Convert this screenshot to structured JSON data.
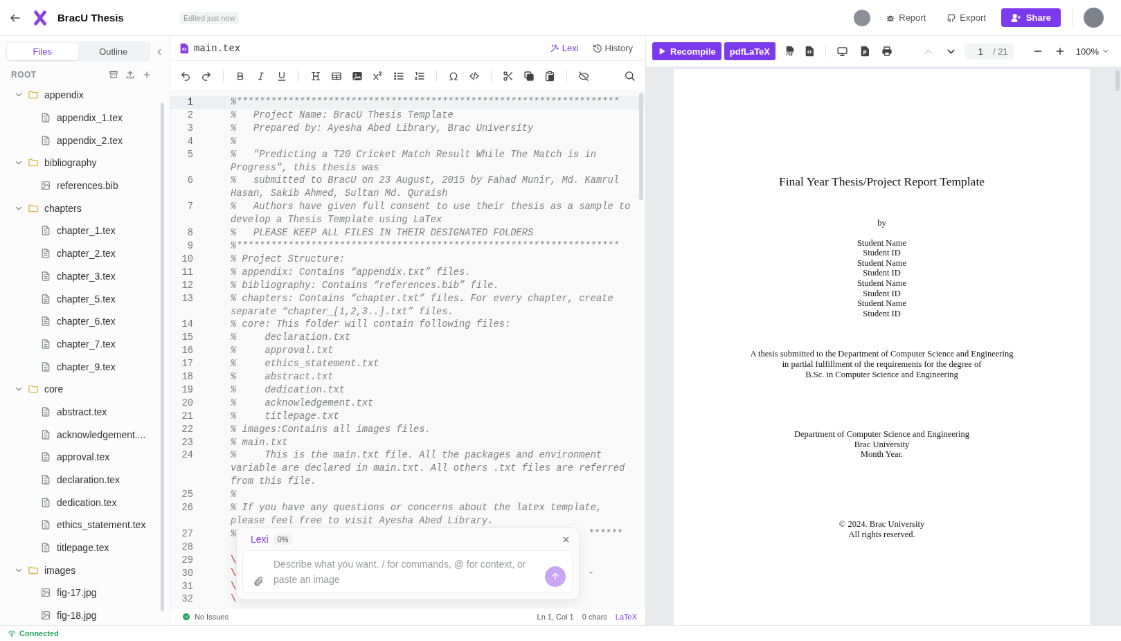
{
  "header": {
    "title": "BracU Thesis",
    "status": "Edited just now",
    "actions": [
      {
        "kind": "link",
        "label": "Report"
      },
      {
        "kind": "link",
        "label": "Export"
      },
      {
        "kind": "primary",
        "label": "Share"
      }
    ]
  },
  "sidebar": {
    "tabs": [
      {
        "label": "Files",
        "selected": true
      },
      {
        "label": "Outline",
        "selected": false
      }
    ],
    "root_label": "ROOT",
    "tree": [
      {
        "kind": "folder",
        "name": "appendix",
        "expanded": true,
        "children": [
          {
            "kind": "document",
            "name": "appendix_1.tex"
          },
          {
            "kind": "document",
            "name": "appendix_2.tex"
          }
        ]
      },
      {
        "kind": "folder",
        "name": "bibliography",
        "expanded": true,
        "children": [
          {
            "kind": "image",
            "name": "references.bib"
          }
        ]
      },
      {
        "kind": "folder",
        "name": "chapters",
        "expanded": true,
        "children": [
          {
            "kind": "document",
            "name": "chapter_1.tex"
          },
          {
            "kind": "document",
            "name": "chapter_2.tex"
          },
          {
            "kind": "document",
            "name": "chapter_3.tex"
          },
          {
            "kind": "document",
            "name": "chapter_5.tex"
          },
          {
            "kind": "document",
            "name": "chapter_6.tex"
          },
          {
            "kind": "document",
            "name": "chapter_7.tex"
          },
          {
            "kind": "document",
            "name": "chapter_9.tex"
          }
        ]
      },
      {
        "kind": "folder",
        "name": "core",
        "expanded": true,
        "children": [
          {
            "kind": "document",
            "name": "abstract.tex"
          },
          {
            "kind": "document",
            "name": "acknowledgement...."
          },
          {
            "kind": "document",
            "name": "approval.tex"
          },
          {
            "kind": "document",
            "name": "declaration.tex"
          },
          {
            "kind": "document",
            "name": "dedication.tex"
          },
          {
            "kind": "document",
            "name": "ethics_statement.tex"
          },
          {
            "kind": "document",
            "name": "titlepage.tex"
          }
        ]
      },
      {
        "kind": "folder",
        "name": "images",
        "expanded": true,
        "children": [
          {
            "kind": "image",
            "name": "fig-17.jpg"
          },
          {
            "kind": "image",
            "name": "fig-18.jpg"
          }
        ]
      }
    ]
  },
  "editor": {
    "file": "main.tex",
    "actions": [
      {
        "kind": "ai",
        "label": "Lexi"
      },
      {
        "kind": "plain",
        "label": "History"
      }
    ],
    "lines": [
      {
        "number": "1",
        "kind": "comment",
        "active": true,
        "text": "%*******************************************************************"
      },
      {
        "number": "2",
        "kind": "comment",
        "active": false,
        "text": "%   Project Name: BracU Thesis Template"
      },
      {
        "number": "3",
        "kind": "comment",
        "active": false,
        "text": "%   Prepared by: Ayesha Abed Library, Brac University"
      },
      {
        "number": "4",
        "kind": "comment",
        "active": false,
        "text": "%"
      },
      {
        "number": "5",
        "kind": "comment",
        "active": false,
        "text": "%   \"Predicting a T20 Cricket Match Result While The Match is in Progress\", this thesis was"
      },
      {
        "number": "6",
        "kind": "comment",
        "active": false,
        "text": "%   submitted to BracU on 23 August, 2015 by Fahad Munir, Md. Kamrul Hasan, Sakib Ahmed, Sultan Md. Quraish"
      },
      {
        "number": "7",
        "kind": "comment",
        "active": false,
        "text": "%   Authors have given full consent to use their thesis as a sample to develop a Thesis Template using LaTex"
      },
      {
        "number": "8",
        "kind": "comment",
        "active": false,
        "text": "%   PLEASE KEEP ALL FILES IN THEIR DESIGNATED FOLDERS"
      },
      {
        "number": "9",
        "kind": "comment",
        "active": false,
        "text": "%*******************************************************************"
      },
      {
        "number": "10",
        "kind": "comment",
        "active": false,
        "text": "% Project Structure:"
      },
      {
        "number": "11",
        "kind": "comment",
        "active": false,
        "text": "% appendix: Contains “appendix.txt” files."
      },
      {
        "number": "12",
        "kind": "comment",
        "active": false,
        "text": "% bibliography: Contains “references.bib” file."
      },
      {
        "number": "13",
        "kind": "comment",
        "active": false,
        "text": "% chapters: Contains “chapter.txt” files. For every chapter, create separate “chapter_[1,2,3..].txt” files."
      },
      {
        "number": "14",
        "kind": "comment",
        "active": false,
        "text": "% core: This folder will contain following files:"
      },
      {
        "number": "15",
        "kind": "comment",
        "active": false,
        "text": "%     declaration.txt"
      },
      {
        "number": "16",
        "kind": "comment",
        "active": false,
        "text": "%     approval.txt"
      },
      {
        "number": "17",
        "kind": "comment",
        "active": false,
        "text": "%     ethics_statement.txt"
      },
      {
        "number": "18",
        "kind": "comment",
        "active": false,
        "text": "%     abstract.txt"
      },
      {
        "number": "19",
        "kind": "comment",
        "active": false,
        "text": "%     dedication.txt"
      },
      {
        "number": "20",
        "kind": "comment",
        "active": false,
        "text": "%     acknowledgement.txt"
      },
      {
        "number": "21",
        "kind": "comment",
        "active": false,
        "text": "%     titlepage.txt"
      },
      {
        "number": "22",
        "kind": "comment",
        "active": false,
        "text": "% images:Contains all images files."
      },
      {
        "number": "23",
        "kind": "comment",
        "active": false,
        "text": "% main.txt"
      },
      {
        "number": "24",
        "kind": "comment",
        "active": false,
        "text": "%     This is the main.txt file. All the packages and environment variable are declared in main.txt. All others .txt files are referred from this file."
      },
      {
        "number": "25",
        "kind": "comment",
        "active": false,
        "text": "%"
      },
      {
        "number": "26",
        "kind": "comment",
        "active": false,
        "text": "% If you have any questions or concerns about the latex template, please feel free to visit Ayesha Abed Library."
      },
      {
        "number": "27",
        "kind": "comment",
        "active": false,
        "text": "%",
        "tail": "******"
      },
      {
        "number": "28",
        "kind": "blank",
        "active": false
      },
      {
        "number": "29",
        "kind": "command",
        "active": false,
        "text": "\\"
      },
      {
        "number": "30",
        "kind": "command",
        "active": false,
        "text": "\\",
        "tail": "-"
      },
      {
        "number": "31",
        "kind": "command",
        "active": false,
        "text": "\\"
      },
      {
        "number": "32",
        "kind": "command",
        "active": false,
        "text": "\\"
      }
    ],
    "status": {
      "issues": "No Issues",
      "position": "Ln 1, Col 1",
      "chars": "0 chars",
      "language": "LaTeX"
    },
    "assistant": {
      "title": "Lexi",
      "progress": "0%",
      "placeholder": "Describe what you want. / for commands, @ for context, or paste an image"
    }
  },
  "pdf": {
    "compile": "Recompile",
    "engine": "pdfLaTeX",
    "nav": [
      {
        "kind": "previous",
        "disabled": true
      },
      {
        "kind": "next",
        "disabled": false
      }
    ],
    "page": "1",
    "total": "/ 21",
    "zoom": "100%",
    "document": {
      "title": "Final Year Thesis/Project Report Template",
      "by": "by",
      "authors": [
        "Student Name",
        "Student ID",
        "Student Name",
        "Student ID",
        "Student Name",
        "Student ID",
        "Student Name",
        "Student ID"
      ],
      "submission": [
        "A thesis submitted to the Department of Computer Science and Engineering",
        "in partial fulfillment of the requirements for the degree of",
        "B.Sc. in Computer Science and Engineering"
      ],
      "department": [
        "Department of Computer Science and Engineering",
        "Brac University",
        "Month Year."
      ],
      "copyright": [
        "© 2024. Brac University",
        "All rights reserved."
      ]
    }
  },
  "footer": {
    "connection": "Connected"
  }
}
